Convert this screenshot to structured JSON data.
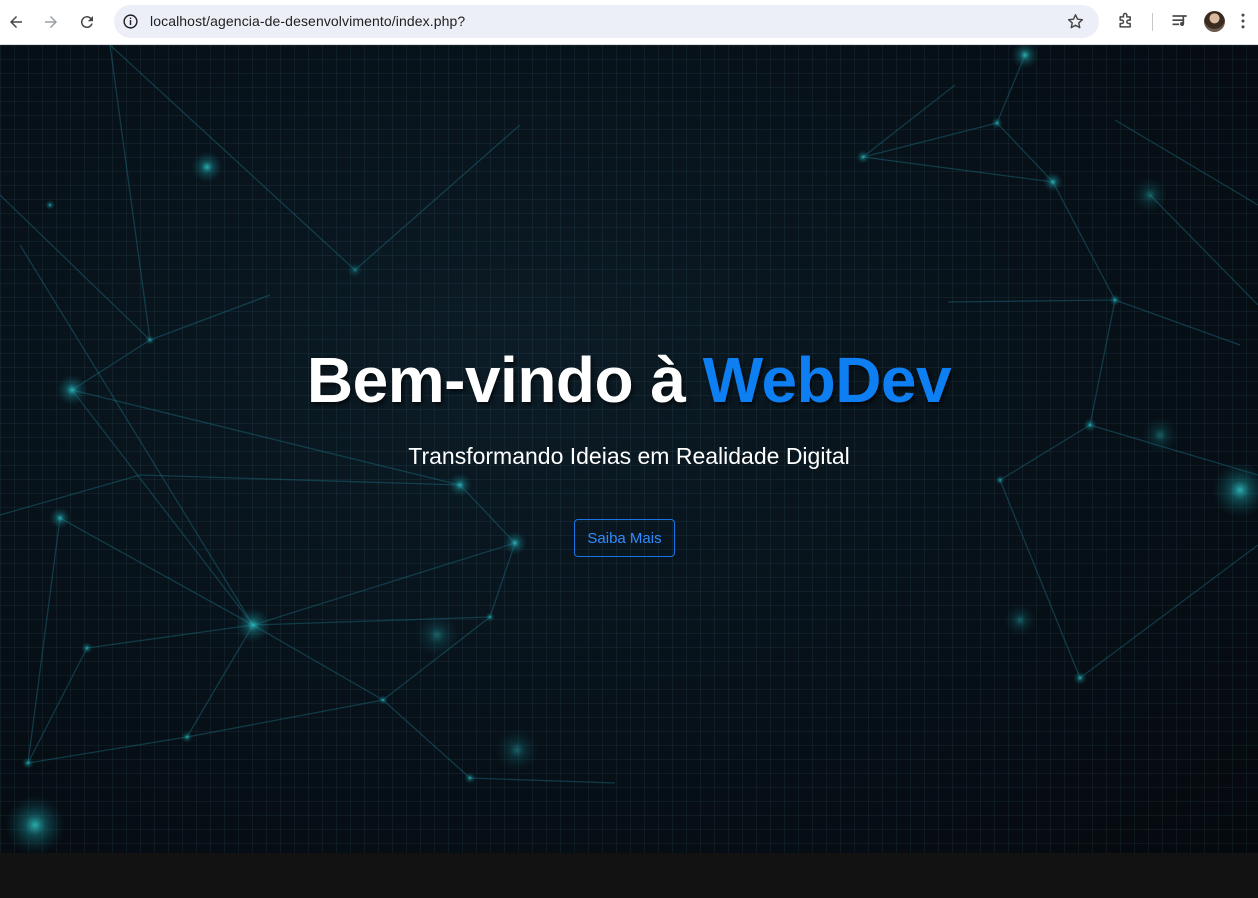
{
  "browser": {
    "url": "localhost/agencia-de-desenvolvimento/index.php?",
    "icons": [
      "back-arrow-icon",
      "forward-arrow-icon",
      "reload-icon",
      "site-info-icon",
      "bookmark-star-icon",
      "extensions-puzzle-icon",
      "media-queue-icon",
      "profile-avatar",
      "more-vert-icon"
    ]
  },
  "hero": {
    "title_prefix": "Bem-vindo à ",
    "title_brand": "WebDev",
    "subtitle": "Transformando Ideias em Realidade Digital",
    "cta_label": "Saiba Mais"
  },
  "colors": {
    "brand": "#0d7ff2",
    "cta_border": "#1a74e8",
    "background": "#060d14",
    "network": "#1e8c96"
  }
}
